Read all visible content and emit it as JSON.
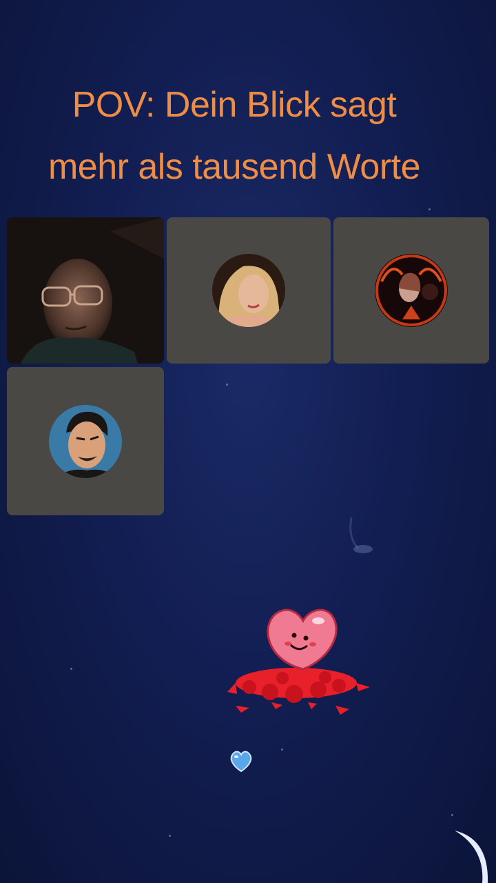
{
  "caption": {
    "line1": "POV: Dein Blick sagt",
    "line2": "mehr als tausend Worte"
  },
  "participants": [
    {
      "type": "camera-video",
      "description": "man-with-glasses"
    },
    {
      "type": "avatar",
      "description": "blonde-woman-avatar"
    },
    {
      "type": "avatar",
      "description": "fantasy-portrait-avatar"
    },
    {
      "type": "avatar",
      "description": "cartoon-man-avatar"
    }
  ],
  "stickers": [
    "heart-character-sticker",
    "blue-heart-sticker",
    "crescent-moon"
  ],
  "colors": {
    "caption": "#f08d45",
    "tile": "#4a4845",
    "background": "#121e52"
  }
}
